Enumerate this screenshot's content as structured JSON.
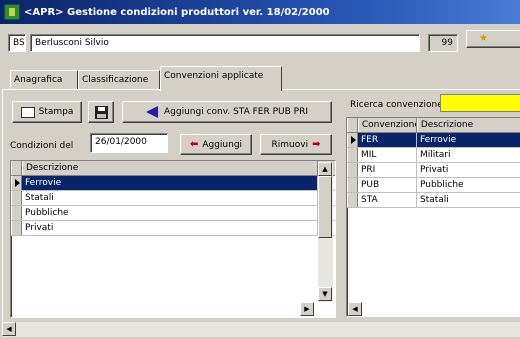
{
  "window": {
    "title": "<APR> Gestione condizioni produttori ver. 18/02/2000"
  },
  "header": {
    "code": "BS",
    "name": "Berlusconi Silvio",
    "counter": "99"
  },
  "tabs": [
    {
      "label": "Anagrafica"
    },
    {
      "label": "Classificazione"
    },
    {
      "label": "Convenzioni applicate"
    }
  ],
  "toolbar": {
    "print_label": "Stampa",
    "add_conv_label": "Aggiungi conv. STA FER PUB PRI"
  },
  "conditions": {
    "label": "Condizioni del",
    "date": "26/01/2000",
    "add_label": "Aggiungi",
    "remove_label": "Rimuovi"
  },
  "left_grid": {
    "header": "Descrizione",
    "rows": [
      "Ferrovie",
      "Statali",
      "Pubbliche",
      "Privati"
    ]
  },
  "search": {
    "label": "Ricerca convenzione",
    "value": ""
  },
  "right_grid": {
    "headers": [
      "Convenzione",
      "Descrizione"
    ],
    "rows": [
      {
        "code": "FER",
        "desc": "Ferrovie"
      },
      {
        "code": "MIL",
        "desc": "Militari"
      },
      {
        "code": "PRI",
        "desc": "Privati"
      },
      {
        "code": "PUB",
        "desc": "Pubbliche"
      },
      {
        "code": "STA",
        "desc": "Statali"
      }
    ]
  },
  "colors": {
    "titlebar": "#0a246a",
    "selection": "#0a246a",
    "search_highlight": "#ffff00"
  }
}
